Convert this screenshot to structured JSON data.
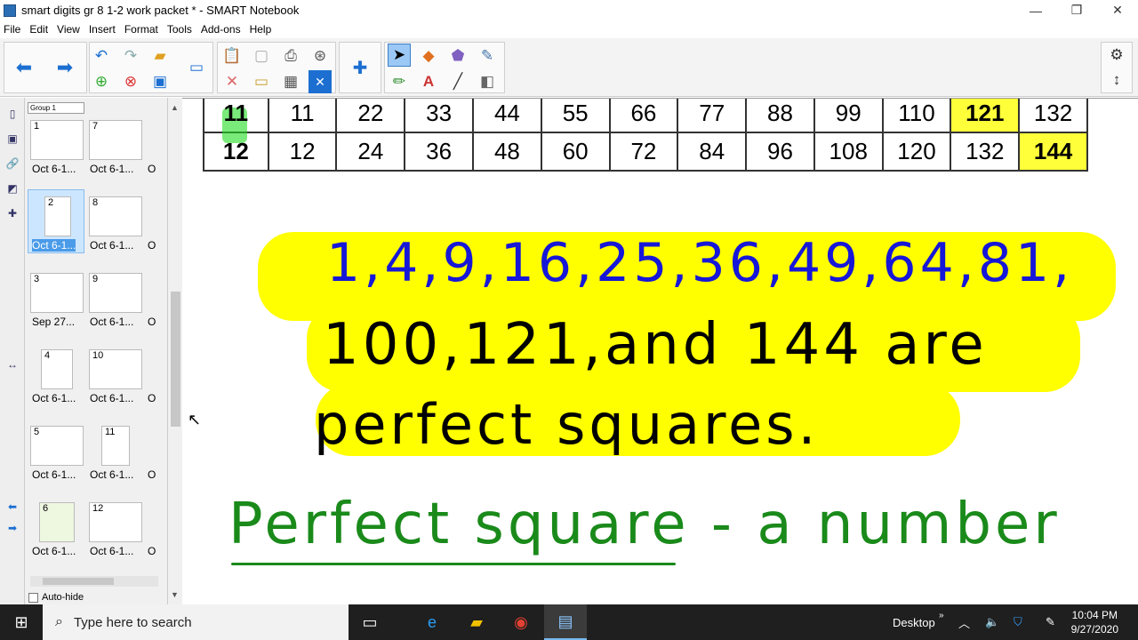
{
  "window": {
    "title": "smart digits gr 8 1-2 work packet * - SMART Notebook",
    "minimize": "—",
    "maximize": "❐",
    "close": "✕"
  },
  "menu": [
    "File",
    "Edit",
    "View",
    "Insert",
    "Format",
    "Tools",
    "Add-ons",
    "Help"
  ],
  "sorter": {
    "group": "Group 1",
    "pages": [
      {
        "num": "1",
        "label": "Oct 6-1..."
      },
      {
        "num": "2",
        "label": "Oct 6-1..."
      },
      {
        "num": "3",
        "label": "Sep 27..."
      },
      {
        "num": "4",
        "label": "Oct 6-1..."
      },
      {
        "num": "5",
        "label": "Oct 6-1..."
      },
      {
        "num": "6",
        "label": "Oct 6-1..."
      },
      {
        "num": "7",
        "label": "Oct 6-1..."
      },
      {
        "num": "8",
        "label": "Oct 6-1..."
      },
      {
        "num": "9",
        "label": "Oct 6-1..."
      },
      {
        "num": "10",
        "label": "Oct 6-1..."
      },
      {
        "num": "11",
        "label": "Oct 6-1..."
      },
      {
        "num": "12",
        "label": "Oct 6-1..."
      }
    ],
    "third_col_label": "O",
    "autohide": "Auto-hide"
  },
  "table": {
    "rows": [
      {
        "head": "11",
        "cells": [
          "11",
          "22",
          "33",
          "44",
          "55",
          "66",
          "77",
          "88",
          "99",
          "110",
          "121",
          "132"
        ]
      },
      {
        "head": "12",
        "cells": [
          "12",
          "24",
          "36",
          "48",
          "60",
          "72",
          "84",
          "96",
          "108",
          "120",
          "132",
          "144"
        ]
      }
    ]
  },
  "notes": {
    "line1": "1,4,9,16,25,36,49,64,81,",
    "line2": "100,121,and 144 are",
    "line3": "perfect squares.",
    "line4": "Perfect square - a number"
  },
  "taskbar": {
    "search_placeholder": "Type here to search",
    "desktop": "Desktop",
    "time": "10:04 PM",
    "date": "9/27/2020"
  },
  "colors": {
    "highlight": "#ffff00",
    "ink_blue": "#1717d8",
    "ink_green": "#1a8a1a",
    "mark_green": "#22dd22"
  }
}
